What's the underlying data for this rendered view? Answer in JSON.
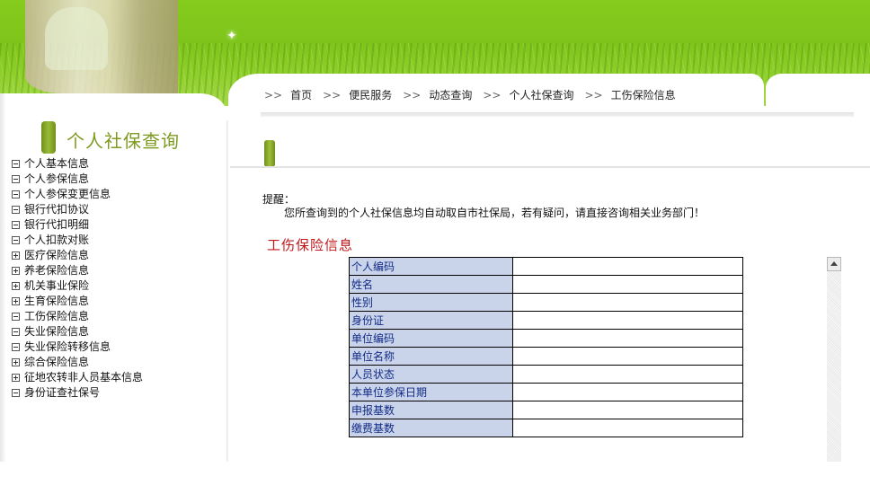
{
  "header": {
    "banner": "banner-photo"
  },
  "breadcrumb": {
    "separator": ">>",
    "items": [
      "首页",
      "便民服务",
      "动态查询",
      "个人社保查询",
      "工伤保险信息"
    ]
  },
  "sidebar": {
    "title": "个人社保查询",
    "items": [
      {
        "label": "个人基本信息",
        "icon": "collapse-icon"
      },
      {
        "label": "个人参保信息",
        "icon": "collapse-icon"
      },
      {
        "label": "个人参保变更信息",
        "icon": "collapse-icon"
      },
      {
        "label": "银行代扣协议",
        "icon": "collapse-icon"
      },
      {
        "label": "银行代扣明细",
        "icon": "collapse-icon"
      },
      {
        "label": "个人扣款对账",
        "icon": "collapse-icon"
      },
      {
        "label": "医疗保险信息",
        "icon": "expand-icon"
      },
      {
        "label": "养老保险信息",
        "icon": "expand-icon"
      },
      {
        "label": "机关事业保险",
        "icon": "expand-icon"
      },
      {
        "label": "生育保险信息",
        "icon": "expand-icon"
      },
      {
        "label": "工伤保险信息",
        "icon": "collapse-icon"
      },
      {
        "label": "失业保险信息",
        "icon": "collapse-icon"
      },
      {
        "label": "失业保险转移信息",
        "icon": "collapse-icon"
      },
      {
        "label": "综合保险信息",
        "icon": "expand-icon"
      },
      {
        "label": "征地农转非人员基本信息",
        "icon": "expand-icon"
      },
      {
        "label": "身份证查社保号",
        "icon": "collapse-icon"
      }
    ]
  },
  "notice": {
    "label": "提醒：",
    "text": "您所查询到的个人社保信息均自动取自市社保局，若有疑问，请直接咨询相关业务部门！"
  },
  "info": {
    "title": "工伤保险信息",
    "fields": [
      {
        "label": "个人编码",
        "value": ""
      },
      {
        "label": "姓名",
        "value": ""
      },
      {
        "label": "性别",
        "value": ""
      },
      {
        "label": "身份证",
        "value": ""
      },
      {
        "label": "单位编码",
        "value": ""
      },
      {
        "label": "单位名称",
        "value": ""
      },
      {
        "label": "人员状态",
        "value": ""
      },
      {
        "label": "本单位参保日期",
        "value": ""
      },
      {
        "label": "申报基数",
        "value": ""
      },
      {
        "label": "缴费基数",
        "value": ""
      }
    ]
  },
  "colors": {
    "accent_green": "#7e9a20",
    "banner_green": "#86cc1e",
    "title_red": "#c0181a",
    "label_bg": "#c9d3ea",
    "label_text": "#132c86"
  }
}
